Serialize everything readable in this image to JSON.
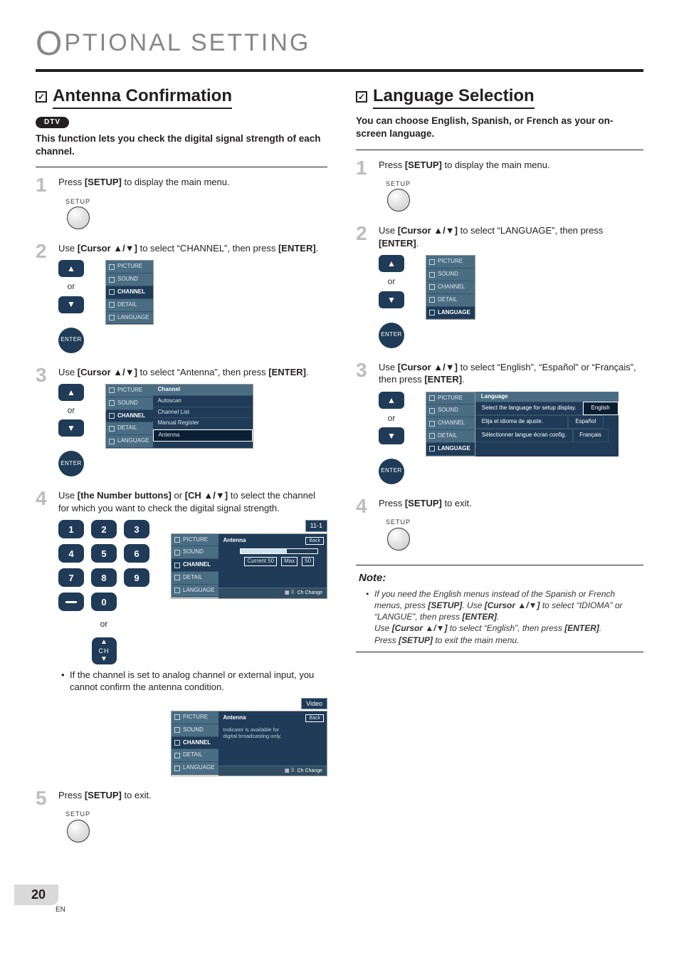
{
  "page": {
    "header": "PTIONAL  SETTING",
    "header_cap": "O",
    "number": "20",
    "lang_code": "EN"
  },
  "common": {
    "setup_label": "SETUP",
    "enter_label": "ENTER",
    "or": "or",
    "ch_label": "CH",
    "menu_tabs": {
      "picture": "PICTURE",
      "sound": "SOUND",
      "channel": "CHANNEL",
      "detail": "DETAIL",
      "language": "LANGUAGE"
    }
  },
  "left": {
    "title": "Antenna Confirmation",
    "badge": "DTV",
    "intro": "This function lets you check the digital signal strength of each channel.",
    "steps": {
      "s1": {
        "pre": "Press ",
        "key": "[SETUP]",
        "post": " to display the main menu."
      },
      "s2": {
        "pre": "Use ",
        "key": "[Cursor ▲/▼]",
        "mid": " to select “CHANNEL”, then press ",
        "key2": "[ENTER]",
        "post": "."
      },
      "s3": {
        "pre": "Use ",
        "key": "[Cursor ▲/▼]",
        "mid": " to select “Antenna”, then press ",
        "key2": "[ENTER]",
        "post": ".",
        "menu_header": "Channel",
        "menu_items": [
          "Autoscan",
          "Channel List",
          "Manual Register",
          "Antenna"
        ]
      },
      "s4": {
        "pre": "Use ",
        "key": "[the Number buttons]",
        "mid": " or ",
        "key2": "[CH ▲/▼]",
        "post": " to select the channel for which you want to check the digital signal strength.",
        "numpad": [
          "1",
          "2",
          "3",
          "4",
          "5",
          "6",
          "7",
          "8",
          "9",
          "0"
        ],
        "flag": "11-1",
        "pane_header": "Antenna",
        "back": "Back",
        "sig_current": "Current 50",
        "sig_max": "Max",
        "sig_maxval": "50",
        "footer": "Ch Change",
        "bullet": "If the channel is set to analog channel or external input, you cannot confirm the antenna condition.",
        "flag2": "Video",
        "pane2_header": "Antenna",
        "pane2_note": "Indicator is available for digital broadcasting only."
      },
      "s5": {
        "pre": "Press ",
        "key": "[SETUP]",
        "post": " to exit."
      }
    }
  },
  "right": {
    "title": "Language Selection",
    "intro": "You can choose English, Spanish, or French as your on-screen language.",
    "steps": {
      "s1": {
        "pre": "Press ",
        "key": "[SETUP]",
        "post": " to display the main menu."
      },
      "s2": {
        "pre": "Use ",
        "key": "[Cursor ▲/▼]",
        "mid": " to select “LANGUAGE”, then press ",
        "key2": "[ENTER]",
        "post": "."
      },
      "s3": {
        "pre": "Use ",
        "key": "[Cursor ▲/▼]",
        "mid": " to select “English”, “Español” or “Français”, then press ",
        "key2": "[ENTER]",
        "post": ".",
        "table_header": "Language",
        "row1": {
          "label": "Select the language for setup display.",
          "opt": "English"
        },
        "row2": {
          "label": "Elija el idioma de ajuste.",
          "opt": "Español"
        },
        "row3": {
          "label": "Sélectionner langue écran config.",
          "opt": "Français"
        }
      },
      "s4": {
        "pre": "Press ",
        "key": "[SETUP]",
        "post": " to exit."
      }
    },
    "note": {
      "header": "Note:",
      "l1a": "If you need the English menus instead of the Spanish or French menus, press ",
      "l1b": "[SETUP]",
      "l1c": ". Use ",
      "l1d": "[Cursor ▲/▼]",
      "l1e": " to select “IDIOMA” or “LANGUE”, then press ",
      "l1f": "[ENTER]",
      "l1g": ".",
      "l2a": "Use ",
      "l2b": "[Cursor ▲/▼]",
      "l2c": " to select “English”, then press ",
      "l2d": "[ENTER]",
      "l2e": ".",
      "l3a": "Press ",
      "l3b": "[SETUP]",
      "l3c": " to exit the main menu."
    }
  }
}
